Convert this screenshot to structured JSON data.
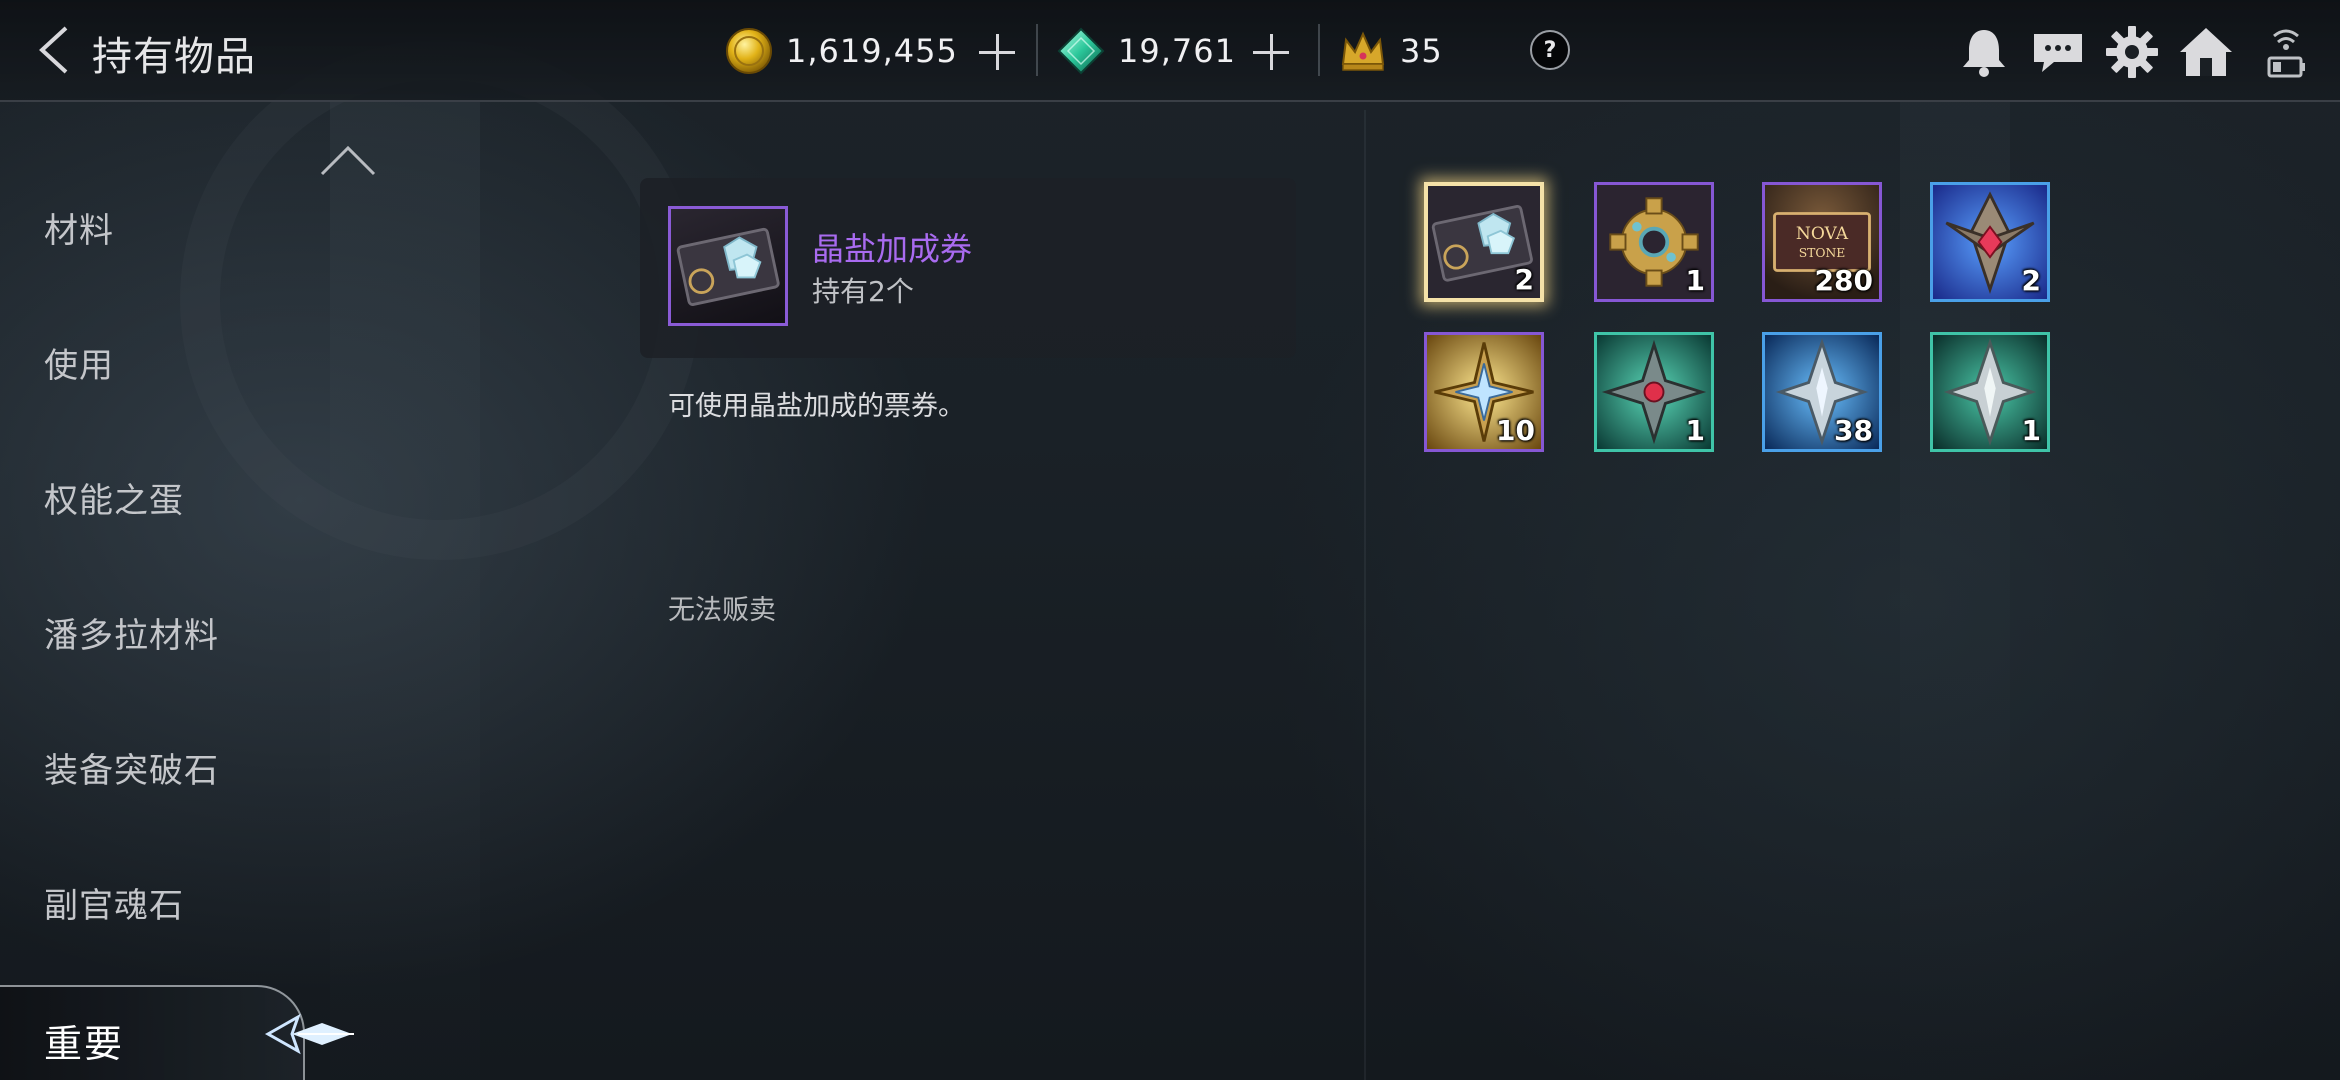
{
  "header": {
    "title": "持有物品",
    "currencies": {
      "gold": {
        "icon": "gold-coin-icon",
        "value": "1,619,455"
      },
      "gem": {
        "icon": "green-gem-icon",
        "value": "19,761"
      },
      "crown": {
        "icon": "crown-icon",
        "value": "35"
      }
    },
    "help_label": "?",
    "icons": [
      "bell-icon",
      "chat-icon",
      "gear-icon",
      "home-icon",
      "wifi-battery-icon"
    ]
  },
  "nav": {
    "items": [
      "材料",
      "使用",
      "权能之蛋",
      "潘多拉材料",
      "装备突破石",
      "副官魂石"
    ],
    "active": "重要"
  },
  "detail": {
    "name": "晶盐加成券",
    "owned": "持有2个",
    "description": "可使用晶盐加成的票券。",
    "sell_status": "无法贩卖",
    "name_color": "#a96bf0"
  },
  "inventory": [
    {
      "name": "crystal-salt-ticket",
      "count": "2",
      "rarity": "purple",
      "selected": true
    },
    {
      "name": "gear-material",
      "count": "1",
      "rarity": "purple",
      "selected": false
    },
    {
      "name": "nova-stone-ticket",
      "count": "280",
      "rarity": "purple",
      "selected": false
    },
    {
      "name": "red-core-crest",
      "count": "2",
      "rarity": "blue",
      "selected": false
    },
    {
      "name": "gold-star-crest",
      "count": "10",
      "rarity": "purple",
      "selected": false
    },
    {
      "name": "teal-ruby-crest",
      "count": "1",
      "rarity": "teal",
      "selected": false
    },
    {
      "name": "blue-silver-crest",
      "count": "38",
      "rarity": "blue",
      "selected": false
    },
    {
      "name": "teal-silver-crest",
      "count": "1",
      "rarity": "teal",
      "selected": false
    }
  ],
  "nova_ticket": {
    "line1": "NOVA",
    "line2": "STONE"
  }
}
